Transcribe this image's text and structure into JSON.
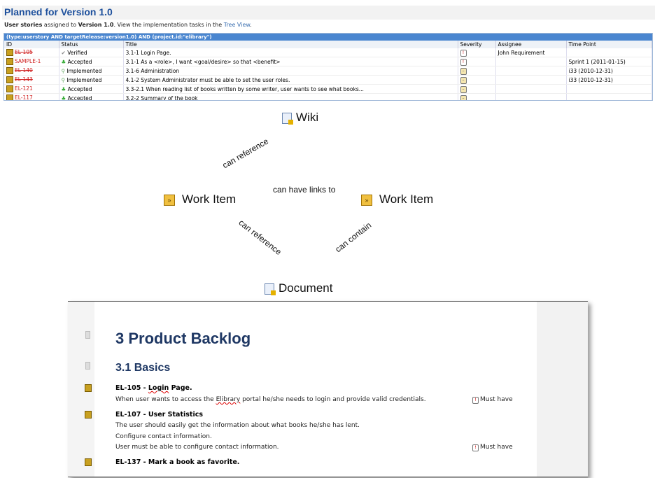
{
  "header": {
    "title": "Planned for Version 1.0",
    "sub_bold1": "User stories",
    "sub_t1": " assigned to ",
    "sub_bold2": "Version 1.0",
    "sub_t2": ". View the implementation tasks in the ",
    "sub_link": "Tree View",
    "sub_t3": "."
  },
  "table": {
    "query": "(type:userstory AND targetRelease:version1.0) AND (project.id:\"elibrary\")",
    "columns": [
      "ID",
      "Status",
      "Title",
      "Severity",
      "Assignee",
      "Time Point"
    ],
    "rows": [
      {
        "id": "EL-105",
        "status": "Verified",
        "title": "3.1-1 Login Page.",
        "severity": "!",
        "assignee": "John Requirement",
        "time": ""
      },
      {
        "id": "SAMPLE-1",
        "status": "Accepted",
        "title": "3.1-1 As a <role>, I want <goal/desire> so that <benefit>",
        "severity": "!",
        "assignee": "",
        "time": "Sprint 1 (2011-01-15)"
      },
      {
        "id": "EL-140",
        "status": "Implemented",
        "title": "3.1-6 Administration",
        "severity": "–",
        "assignee": "",
        "time": "i33 (2010-12-31)"
      },
      {
        "id": "EL-143",
        "status": "Implemented",
        "title": "4.1-2 System Administrator must be able to set the user roles.",
        "severity": "–",
        "assignee": "",
        "time": "i33 (2010-12-31)"
      },
      {
        "id": "EL-121",
        "status": "Accepted",
        "title": "3.3-2.1 When reading list of books written by some writer, user wants to see what books...",
        "severity": "–",
        "assignee": "",
        "time": ""
      },
      {
        "id": "EL-117",
        "status": "Accepted",
        "title": "3.2-2 Summary of the book",
        "severity": "–",
        "assignee": "",
        "time": ""
      }
    ]
  },
  "diagram": {
    "wiki": "Wiki",
    "work_item_left": "Work Item",
    "work_item_right": "Work Item",
    "document": "Document",
    "rel_wiki": "can reference",
    "rel_links": "can have links to",
    "rel_doc": "can reference",
    "rel_contain": "can contain"
  },
  "doc": {
    "h1": "3  Product Backlog",
    "h2": "3.1 Basics",
    "e1_title_a": "EL-105 - ",
    "e1_title_b": "Login",
    " e1_title_c": " Page.",
    "e1_text_a": "When user wants to access the ",
    "e1_text_b": "Elibrary",
    "e1_text_c": " portal he/she needs to login and provide valid credentials.",
    "must1": "Must have",
    "e2_title": "EL-107 - User Statistics",
    "e2_l1": "The user should easily get the information about what books he/she has lent.",
    "e2_l2": "Configure contact information.",
    "e2_l3": "User must be able to configure contact information.",
    "must2": "Must have",
    "e3_title": "EL-137 - Mark a book as favorite."
  }
}
